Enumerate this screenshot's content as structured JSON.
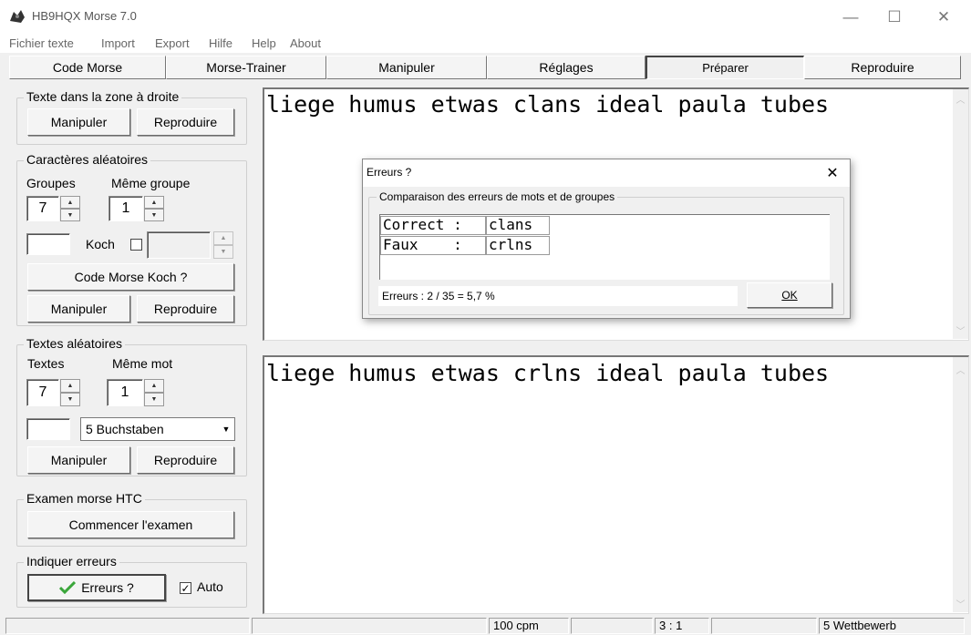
{
  "window": {
    "title": "HB9HQX Morse 7.0",
    "controls": {
      "minimize": "—",
      "maximize": "☐",
      "close": "✕"
    }
  },
  "menu": [
    "Fichier texte",
    "Import",
    "Export",
    "Hilfe",
    "Help",
    "About"
  ],
  "tabs": [
    "Code Morse",
    "Morse-Trainer",
    "Manipuler",
    "Réglages",
    "Préparer",
    "Reproduire"
  ],
  "active_tab": "Préparer",
  "sidebar": {
    "text_zone": {
      "title": "Texte dans la zone à droite",
      "manipulate": "Manipuler",
      "reproduce": "Reproduire"
    },
    "random_chars": {
      "title": "Caractères aléatoires",
      "groups_label": "Groupes",
      "groups_value": "7",
      "same_group_label": "Même groupe",
      "same_group_value": "1",
      "koch_label": "Koch",
      "koch_checked": false,
      "koch_button": "Code Morse Koch ?",
      "manipulate": "Manipuler",
      "reproduce": "Reproduire"
    },
    "random_texts": {
      "title": "Textes aléatoires",
      "texts_label": "Textes",
      "texts_value": "7",
      "same_word_label": "Même mot",
      "same_word_value": "1",
      "dropdown_value": "5 Buchstaben",
      "manipulate": "Manipuler",
      "reproduce": "Reproduire"
    },
    "exam": {
      "title": "Examen morse HTC",
      "start": "Commencer l'examen"
    },
    "errors": {
      "title": "Indiquer erreurs",
      "button": "Erreurs ?",
      "auto_label": "Auto",
      "auto_checked": true
    }
  },
  "main": {
    "top_text": "liege humus etwas clans ideal paula tubes",
    "bottom_text": "liege humus etwas crlns ideal paula tubes"
  },
  "dialog": {
    "title": "Erreurs ?",
    "group_title": "Comparaison des erreurs de mots et de groupes",
    "rows": [
      {
        "label": "Correct :",
        "value": "clans"
      },
      {
        "label": "Faux    :",
        "value": "crlns"
      }
    ],
    "errors_text": "Erreurs :  2 / 35 = 5,7 %",
    "ok": "OK"
  },
  "status": {
    "speed": "100 cpm",
    "ratio": "3 : 1",
    "mode": "5 Wettbewerb"
  },
  "colors": {
    "check_green": "#3aa63a",
    "window_bg": "#f0f0f0"
  }
}
